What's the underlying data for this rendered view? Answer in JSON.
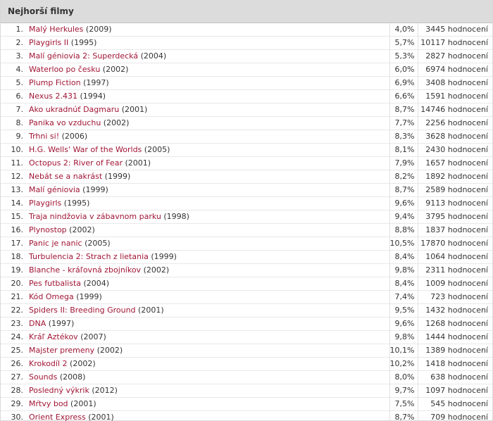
{
  "header": {
    "title": "Nejhorší filmy"
  },
  "films": [
    {
      "rank": "1.",
      "title": "Malý Herkules",
      "year": "(2009)",
      "rating": "4,0%",
      "count": "3445 hodnocení"
    },
    {
      "rank": "2.",
      "title": "Playgirls II",
      "year": "(1995)",
      "rating": "5,7%",
      "count": "10117 hodnocení"
    },
    {
      "rank": "3.",
      "title": "Malí géniovia 2: Superdecká",
      "year": "(2004)",
      "rating": "5,3%",
      "count": "2827 hodnocení"
    },
    {
      "rank": "4.",
      "title": "Waterloo po česku",
      "year": "(2002)",
      "rating": "6,0%",
      "count": "6974 hodnocení"
    },
    {
      "rank": "5.",
      "title": "Plump Fiction",
      "year": "(1997)",
      "rating": "6,9%",
      "count": "3408 hodnocení"
    },
    {
      "rank": "6.",
      "title": "Nexus 2.431",
      "year": "(1994)",
      "rating": "6,6%",
      "count": "1591 hodnocení"
    },
    {
      "rank": "7.",
      "title": "Ako ukradnúť Dagmaru",
      "year": "(2001)",
      "rating": "8,7%",
      "count": "14746 hodnocení"
    },
    {
      "rank": "8.",
      "title": "Panika vo vzduchu",
      "year": "(2002)",
      "rating": "7,7%",
      "count": "2256 hodnocení"
    },
    {
      "rank": "9.",
      "title": "Trhni si!",
      "year": "(2006)",
      "rating": "8,3%",
      "count": "3628 hodnocení"
    },
    {
      "rank": "10.",
      "title": "H.G. Wells' War of the Worlds",
      "year": "(2005)",
      "rating": "8,1%",
      "count": "2430 hodnocení"
    },
    {
      "rank": "11.",
      "title": "Octopus 2: River of Fear",
      "year": "(2001)",
      "rating": "7,9%",
      "count": "1657 hodnocení"
    },
    {
      "rank": "12.",
      "title": "Nebát se a nakrást",
      "year": "(1999)",
      "rating": "8,2%",
      "count": "1892 hodnocení"
    },
    {
      "rank": "13.",
      "title": "Malí géniovia",
      "year": "(1999)",
      "rating": "8,7%",
      "count": "2589 hodnocení"
    },
    {
      "rank": "14.",
      "title": "Playgirls",
      "year": "(1995)",
      "rating": "9,6%",
      "count": "9113 hodnocení"
    },
    {
      "rank": "15.",
      "title": "Traja nindžovia v zábavnom parku",
      "year": "(1998)",
      "rating": "9,4%",
      "count": "3795 hodnocení"
    },
    {
      "rank": "16.",
      "title": "Plynostop",
      "year": "(2002)",
      "rating": "8,8%",
      "count": "1837 hodnocení"
    },
    {
      "rank": "17.",
      "title": "Panic je nanic",
      "year": "(2005)",
      "rating": "10,5%",
      "count": "17870 hodnocení"
    },
    {
      "rank": "18.",
      "title": "Turbulencia 2: Strach z lietania",
      "year": "(1999)",
      "rating": "8,4%",
      "count": "1064 hodnocení"
    },
    {
      "rank": "19.",
      "title": "Blanche - kráľovná zbojníkov",
      "year": "(2002)",
      "rating": "9,8%",
      "count": "2311 hodnocení"
    },
    {
      "rank": "20.",
      "title": "Pes futbalista",
      "year": "(2004)",
      "rating": "8,4%",
      "count": "1009 hodnocení"
    },
    {
      "rank": "21.",
      "title": "Kód Omega",
      "year": "(1999)",
      "rating": "7,4%",
      "count": "723 hodnocení"
    },
    {
      "rank": "22.",
      "title": "Spiders II: Breeding Ground",
      "year": "(2001)",
      "rating": "9,5%",
      "count": "1432 hodnocení"
    },
    {
      "rank": "23.",
      "title": "DNA",
      "year": "(1997)",
      "rating": "9,6%",
      "count": "1268 hodnocení"
    },
    {
      "rank": "24.",
      "title": "Kráľ Aztékov",
      "year": "(2007)",
      "rating": "9,8%",
      "count": "1444 hodnocení"
    },
    {
      "rank": "25.",
      "title": "Majster premeny",
      "year": "(2002)",
      "rating": "10,1%",
      "count": "1389 hodnocení"
    },
    {
      "rank": "26.",
      "title": "Krokodíl 2",
      "year": "(2002)",
      "rating": "10,2%",
      "count": "1418 hodnocení"
    },
    {
      "rank": "27.",
      "title": "Sounds",
      "year": "(2008)",
      "rating": "8,0%",
      "count": "638 hodnocení"
    },
    {
      "rank": "28.",
      "title": "Posledný výkrik",
      "year": "(2012)",
      "rating": "9,7%",
      "count": "1097 hodnocení"
    },
    {
      "rank": "29.",
      "title": "Mŕtvy bod",
      "year": "(2001)",
      "rating": "7,5%",
      "count": "545 hodnocení"
    },
    {
      "rank": "30.",
      "title": "Orient Express",
      "year": "(2001)",
      "rating": "8,7%",
      "count": "709 hodnocení"
    }
  ]
}
